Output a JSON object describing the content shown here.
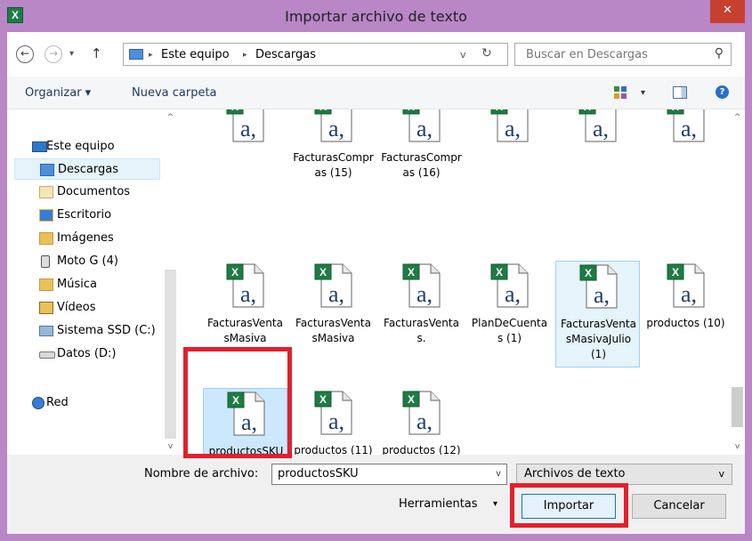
{
  "window": {
    "title": "Importar archivo de texto",
    "app_icon": "X",
    "close_glyph": "✕"
  },
  "nav": {
    "back_glyph": "←",
    "forward_glyph": "→",
    "recent_glyph": "▾",
    "up_glyph": "↑",
    "breadcrumb": [
      "Este equipo",
      "Descargas"
    ],
    "separator": "▸",
    "dropdown_glyph": "v",
    "refresh_glyph": "↻"
  },
  "search": {
    "placeholder": "Buscar en Descargas",
    "icon_glyph": "⚲"
  },
  "toolbar": {
    "organize_label": "Organizar ▾",
    "new_folder_label": "Nueva carpeta",
    "view_dropdown_glyph": "▾",
    "help_glyph": "?"
  },
  "sidebar": {
    "items": [
      {
        "label": "Este equipo",
        "icon": "computer-icon"
      },
      {
        "label": "Descargas",
        "icon": "downloads-folder-icon",
        "selected": true
      },
      {
        "label": "Documentos",
        "icon": "documents-folder-icon"
      },
      {
        "label": "Escritorio",
        "icon": "desktop-folder-icon"
      },
      {
        "label": "Imágenes",
        "icon": "pictures-folder-icon"
      },
      {
        "label": "Moto G (4)",
        "icon": "phone-icon"
      },
      {
        "label": "Música",
        "icon": "music-folder-icon"
      },
      {
        "label": "Vídeos",
        "icon": "videos-folder-icon"
      },
      {
        "label": "Sistema SSD (C:)",
        "icon": "drive-c-icon"
      },
      {
        "label": "Datos  (D:)",
        "icon": "drive-d-icon"
      },
      {
        "label": "Red",
        "icon": "network-icon"
      }
    ]
  },
  "files": [
    {
      "name": ""
    },
    {
      "name": "FacturasCompras (15)"
    },
    {
      "name": "FacturasCompras (16)"
    },
    {
      "name": ""
    },
    {
      "name": ""
    },
    {
      "name": ""
    },
    {
      "name": "FacturasVentasMasiva"
    },
    {
      "name": "FacturasVentasMasiva"
    },
    {
      "name": "FacturasVentas."
    },
    {
      "name": "PlanDeCuentas (1)"
    },
    {
      "name": "FacturasVentasMasivaJulio (1)"
    },
    {
      "name": "productos (10)"
    },
    {
      "name": "productosSKU"
    },
    {
      "name": "productos (11)"
    },
    {
      "name": "productos (12)"
    }
  ],
  "file_icon_letter": "a,",
  "file_icon_badge": "X",
  "filename": {
    "label": "Nombre de archivo:",
    "value": "productosSKU",
    "dropdown_glyph": "v"
  },
  "filetype": {
    "value": "Archivos de texto",
    "dropdown_glyph": "v"
  },
  "tools_label": "Herramientas",
  "tools_dropdown_glyph": "▾",
  "buttons": {
    "import_label": "Importar",
    "cancel_label": "Cancelar"
  },
  "scroll_glyphs": {
    "up": "^",
    "down": "v"
  },
  "colors": {
    "window_frame": "#b986c6",
    "close_button": "#c7402e",
    "highlight": "#e3202a",
    "selection": "#cce8ff"
  }
}
